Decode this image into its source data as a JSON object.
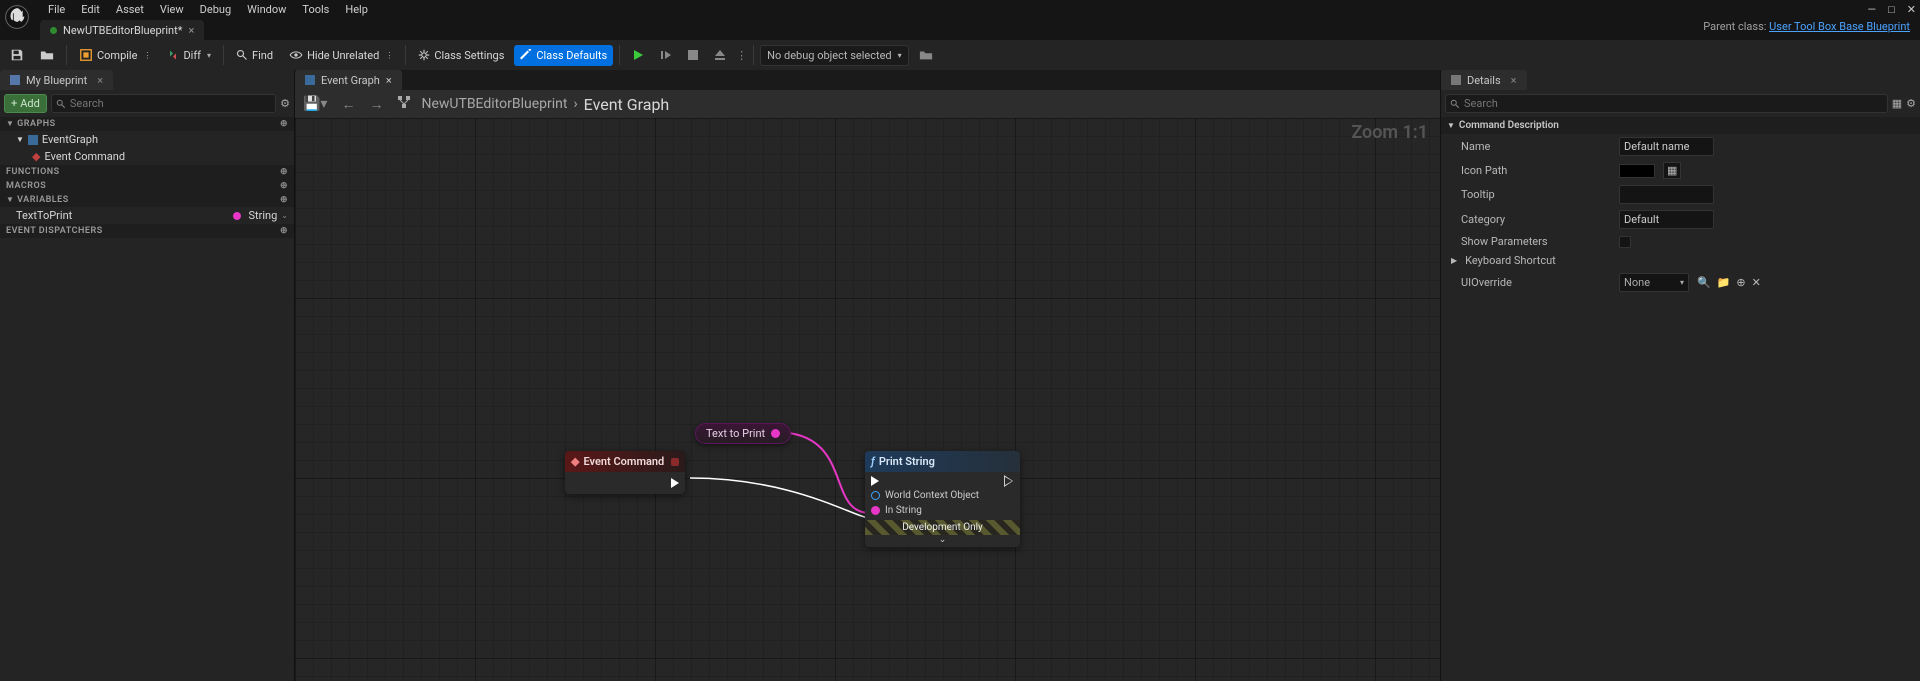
{
  "menu": {
    "items": [
      "File",
      "Edit",
      "Asset",
      "View",
      "Debug",
      "Window",
      "Tools",
      "Help"
    ]
  },
  "window": {
    "min": "—",
    "max": "□",
    "close": "✕"
  },
  "docTab": {
    "title": "NewUTBEditorBlueprint*"
  },
  "parentClass": {
    "label": "Parent class:",
    "link": "User Tool Box Base Blueprint"
  },
  "toolbar": {
    "compile": "Compile",
    "diff": "Diff",
    "find": "Find",
    "hideUnrelated": "Hide Unrelated",
    "classSettings": "Class Settings",
    "classDefaults": "Class Defaults",
    "noDebug": "No debug object selected"
  },
  "leftPanel": {
    "tab": "My Blueprint",
    "add": "Add",
    "searchPlaceholder": "Search",
    "cats": {
      "graphs": "GRAPHS",
      "functions": "FUNCTIONS",
      "macros": "MACROS",
      "variables": "VARIABLES",
      "dispatchers": "EVENT DISPATCHERS"
    },
    "eventGraph": "EventGraph",
    "eventCommand": "Event Command",
    "var": {
      "name": "TextToPrint",
      "type": "String"
    }
  },
  "centerTabs": {
    "eventGraph": "Event Graph"
  },
  "breadcrumb": {
    "bp": "NewUTBEditorBlueprint",
    "graph": "Event Graph"
  },
  "zoom": "Zoom 1:1",
  "nodes": {
    "var": {
      "label": "Text to Print"
    },
    "event": {
      "title": "Event Command"
    },
    "print": {
      "title": "Print String",
      "pinWorld": "World Context Object",
      "pinIn": "In String",
      "dev": "Development Only"
    }
  },
  "details": {
    "tab": "Details",
    "searchPlaceholder": "Search",
    "cat": "Command Description",
    "props": {
      "name": {
        "label": "Name",
        "value": "Default name"
      },
      "iconPath": {
        "label": "Icon Path"
      },
      "tooltip": {
        "label": "Tooltip",
        "value": ""
      },
      "category": {
        "label": "Category",
        "value": "Default"
      },
      "showParams": {
        "label": "Show Parameters"
      },
      "kbShortcut": {
        "label": "Keyboard Shortcut"
      },
      "uioverride": {
        "label": "UIOverride",
        "value": "None"
      }
    }
  }
}
